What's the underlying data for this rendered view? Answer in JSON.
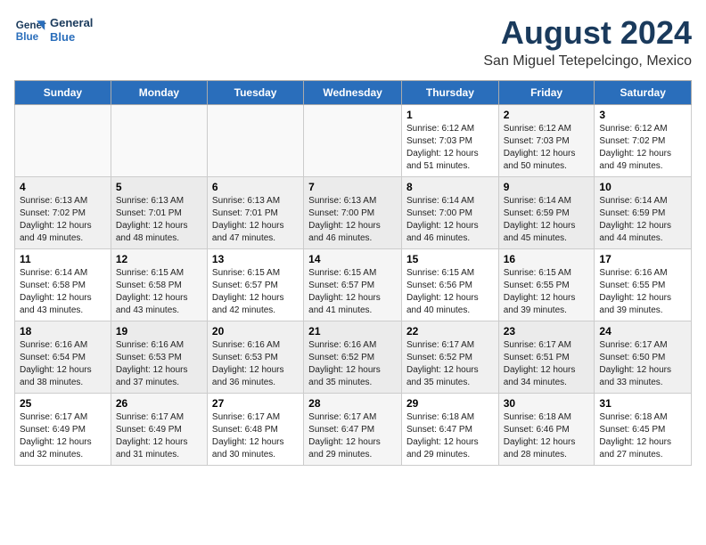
{
  "header": {
    "logo_line1": "General",
    "logo_line2": "Blue",
    "title": "August 2024",
    "subtitle": "San Miguel Tetepelcingo, Mexico"
  },
  "days_of_week": [
    "Sunday",
    "Monday",
    "Tuesday",
    "Wednesday",
    "Thursday",
    "Friday",
    "Saturday"
  ],
  "weeks": [
    {
      "days": [
        {
          "number": "",
          "info": ""
        },
        {
          "number": "",
          "info": ""
        },
        {
          "number": "",
          "info": ""
        },
        {
          "number": "",
          "info": ""
        },
        {
          "number": "1",
          "info": "Sunrise: 6:12 AM\nSunset: 7:03 PM\nDaylight: 12 hours\nand 51 minutes."
        },
        {
          "number": "2",
          "info": "Sunrise: 6:12 AM\nSunset: 7:03 PM\nDaylight: 12 hours\nand 50 minutes."
        },
        {
          "number": "3",
          "info": "Sunrise: 6:12 AM\nSunset: 7:02 PM\nDaylight: 12 hours\nand 49 minutes."
        }
      ]
    },
    {
      "days": [
        {
          "number": "4",
          "info": "Sunrise: 6:13 AM\nSunset: 7:02 PM\nDaylight: 12 hours\nand 49 minutes."
        },
        {
          "number": "5",
          "info": "Sunrise: 6:13 AM\nSunset: 7:01 PM\nDaylight: 12 hours\nand 48 minutes."
        },
        {
          "number": "6",
          "info": "Sunrise: 6:13 AM\nSunset: 7:01 PM\nDaylight: 12 hours\nand 47 minutes."
        },
        {
          "number": "7",
          "info": "Sunrise: 6:13 AM\nSunset: 7:00 PM\nDaylight: 12 hours\nand 46 minutes."
        },
        {
          "number": "8",
          "info": "Sunrise: 6:14 AM\nSunset: 7:00 PM\nDaylight: 12 hours\nand 46 minutes."
        },
        {
          "number": "9",
          "info": "Sunrise: 6:14 AM\nSunset: 6:59 PM\nDaylight: 12 hours\nand 45 minutes."
        },
        {
          "number": "10",
          "info": "Sunrise: 6:14 AM\nSunset: 6:59 PM\nDaylight: 12 hours\nand 44 minutes."
        }
      ]
    },
    {
      "days": [
        {
          "number": "11",
          "info": "Sunrise: 6:14 AM\nSunset: 6:58 PM\nDaylight: 12 hours\nand 43 minutes."
        },
        {
          "number": "12",
          "info": "Sunrise: 6:15 AM\nSunset: 6:58 PM\nDaylight: 12 hours\nand 43 minutes."
        },
        {
          "number": "13",
          "info": "Sunrise: 6:15 AM\nSunset: 6:57 PM\nDaylight: 12 hours\nand 42 minutes."
        },
        {
          "number": "14",
          "info": "Sunrise: 6:15 AM\nSunset: 6:57 PM\nDaylight: 12 hours\nand 41 minutes."
        },
        {
          "number": "15",
          "info": "Sunrise: 6:15 AM\nSunset: 6:56 PM\nDaylight: 12 hours\nand 40 minutes."
        },
        {
          "number": "16",
          "info": "Sunrise: 6:15 AM\nSunset: 6:55 PM\nDaylight: 12 hours\nand 39 minutes."
        },
        {
          "number": "17",
          "info": "Sunrise: 6:16 AM\nSunset: 6:55 PM\nDaylight: 12 hours\nand 39 minutes."
        }
      ]
    },
    {
      "days": [
        {
          "number": "18",
          "info": "Sunrise: 6:16 AM\nSunset: 6:54 PM\nDaylight: 12 hours\nand 38 minutes."
        },
        {
          "number": "19",
          "info": "Sunrise: 6:16 AM\nSunset: 6:53 PM\nDaylight: 12 hours\nand 37 minutes."
        },
        {
          "number": "20",
          "info": "Sunrise: 6:16 AM\nSunset: 6:53 PM\nDaylight: 12 hours\nand 36 minutes."
        },
        {
          "number": "21",
          "info": "Sunrise: 6:16 AM\nSunset: 6:52 PM\nDaylight: 12 hours\nand 35 minutes."
        },
        {
          "number": "22",
          "info": "Sunrise: 6:17 AM\nSunset: 6:52 PM\nDaylight: 12 hours\nand 35 minutes."
        },
        {
          "number": "23",
          "info": "Sunrise: 6:17 AM\nSunset: 6:51 PM\nDaylight: 12 hours\nand 34 minutes."
        },
        {
          "number": "24",
          "info": "Sunrise: 6:17 AM\nSunset: 6:50 PM\nDaylight: 12 hours\nand 33 minutes."
        }
      ]
    },
    {
      "days": [
        {
          "number": "25",
          "info": "Sunrise: 6:17 AM\nSunset: 6:49 PM\nDaylight: 12 hours\nand 32 minutes."
        },
        {
          "number": "26",
          "info": "Sunrise: 6:17 AM\nSunset: 6:49 PM\nDaylight: 12 hours\nand 31 minutes."
        },
        {
          "number": "27",
          "info": "Sunrise: 6:17 AM\nSunset: 6:48 PM\nDaylight: 12 hours\nand 30 minutes."
        },
        {
          "number": "28",
          "info": "Sunrise: 6:17 AM\nSunset: 6:47 PM\nDaylight: 12 hours\nand 29 minutes."
        },
        {
          "number": "29",
          "info": "Sunrise: 6:18 AM\nSunset: 6:47 PM\nDaylight: 12 hours\nand 29 minutes."
        },
        {
          "number": "30",
          "info": "Sunrise: 6:18 AM\nSunset: 6:46 PM\nDaylight: 12 hours\nand 28 minutes."
        },
        {
          "number": "31",
          "info": "Sunrise: 6:18 AM\nSunset: 6:45 PM\nDaylight: 12 hours\nand 27 minutes."
        }
      ]
    }
  ]
}
